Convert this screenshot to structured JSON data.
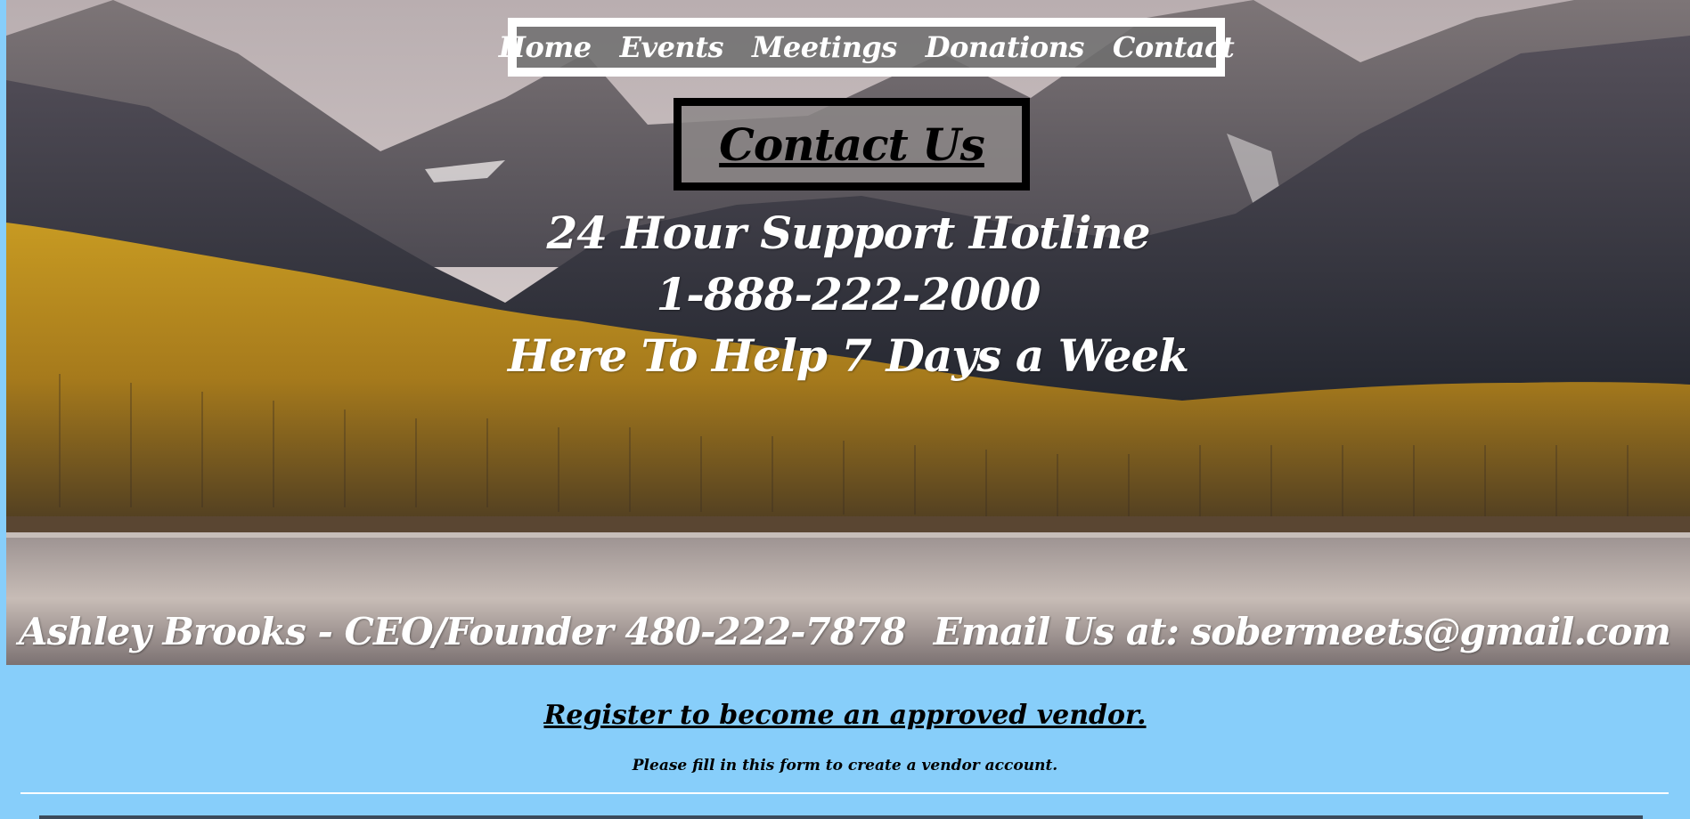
{
  "nav": {
    "items": [
      {
        "label": "Home"
      },
      {
        "label": "Events"
      },
      {
        "label": "Meetings"
      },
      {
        "label": "Donations"
      },
      {
        "label": "Contact"
      }
    ]
  },
  "hero": {
    "heading": "Contact Us",
    "hotline_title": "24 Hour Support Hotline",
    "hotline_number": "1-888-222-2000",
    "hotline_hours": "Here To Help 7 Days a Week",
    "ceo_line": "Ashley Brooks - CEO/Founder 480-222-7878",
    "email_line": "Email Us at: sobermeets@gmail.com"
  },
  "form": {
    "title": "Register to become an approved vendor.",
    "instructions": "Please fill in this form to create a vendor account."
  },
  "colors": {
    "page_background": "#87cefa",
    "nav_border": "#ffffff",
    "heading_box_border": "#000000",
    "text_light": "#ffffff",
    "text_dark": "#000000"
  },
  "icons": {
    "hero_image": "mountain-lake-landscape"
  }
}
